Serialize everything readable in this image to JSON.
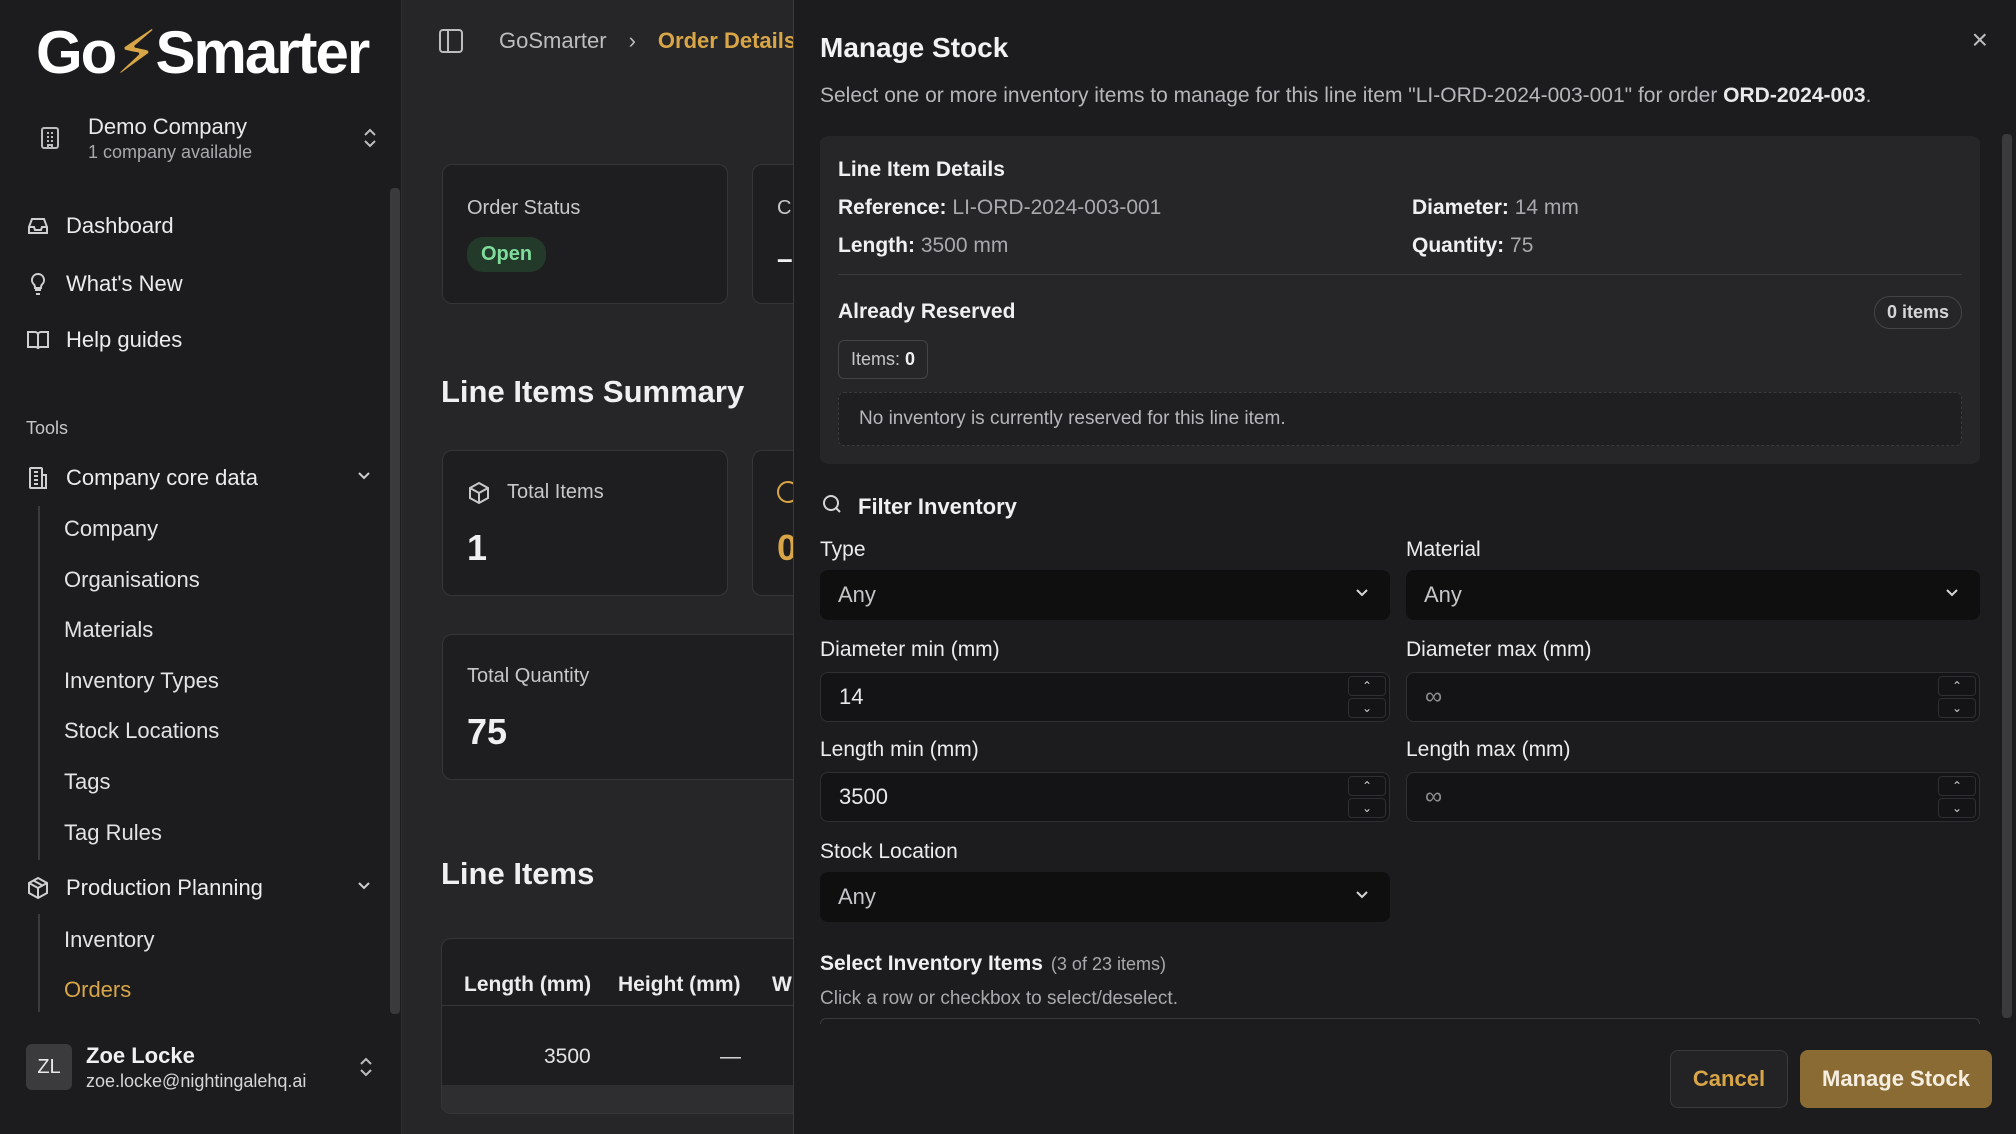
{
  "sidebar": {
    "logo_left": "Go",
    "logo_bolt": "⚡",
    "logo_right": "Smarter",
    "company": {
      "name": "Demo Company",
      "sub": "1 company available"
    },
    "nav": [
      {
        "label": "Dashboard",
        "icon": "inbox-icon"
      },
      {
        "label": "What's New",
        "icon": "lightbulb-icon"
      },
      {
        "label": "Help guides",
        "icon": "book-icon"
      }
    ],
    "tools_label": "Tools",
    "group_core": "Company core data",
    "core_items": [
      "Company",
      "Organisations",
      "Materials",
      "Inventory Types",
      "Stock Locations",
      "Tags",
      "Tag Rules"
    ],
    "group_planning": "Production Planning",
    "planning_items": [
      "Inventory",
      "Orders"
    ],
    "user": {
      "initials": "ZL",
      "name": "Zoe Locke",
      "email": "zoe.locke@nightingalehq.ai"
    }
  },
  "main": {
    "breadcrumb": [
      "GoSmarter",
      "Order Details"
    ],
    "order_status_label": "Order Status",
    "order_status_value": "Open",
    "second_card_label": "C",
    "second_card_value": "–",
    "summary_title": "Line Items Summary",
    "total_items_label": "Total Items",
    "total_items_value": "1",
    "partial_value": "0",
    "total_quantity_label": "Total Quantity",
    "total_quantity_value": "75",
    "line_items_title": "Line Items",
    "table_headers": [
      "Length (mm)",
      "Height (mm)",
      "W"
    ],
    "table_row": [
      "3500",
      "—"
    ]
  },
  "dialog": {
    "title": "Manage Stock",
    "desc_prefix": "Select one or more inventory items to manage for this line item \"LI-ORD-2024-003-001\" for order ",
    "desc_order": "ORD-2024-003",
    "desc_suffix": ".",
    "close": "×",
    "line_item_details": {
      "heading": "Line Item Details",
      "reference_label": "Reference:",
      "reference_value": "LI-ORD-2024-003-001",
      "diameter_label": "Diameter:",
      "diameter_value": "14 mm",
      "length_label": "Length:",
      "length_value": "3500 mm",
      "quantity_label": "Quantity:",
      "quantity_value": "75"
    },
    "already_reserved": {
      "heading": "Already Reserved",
      "pill": "0 items",
      "items_label": "Items:",
      "items_value": "0",
      "empty": "No inventory is currently reserved for this line item."
    },
    "filter": {
      "heading": "Filter Inventory",
      "type_label": "Type",
      "type_value": "Any",
      "material_label": "Material",
      "material_value": "Any",
      "dmin_label": "Diameter min (mm)",
      "dmin_value": "14",
      "dmax_label": "Diameter max (mm)",
      "dmax_placeholder": "∞",
      "lmin_label": "Length min (mm)",
      "lmin_value": "3500",
      "lmax_label": "Length max (mm)",
      "lmax_placeholder": "∞",
      "location_label": "Stock Location",
      "location_value": "Any"
    },
    "select": {
      "heading": "Select Inventory Items",
      "count": "(3 of 23 items)",
      "hint": "Click a row or checkbox to select/deselect."
    },
    "cancel_label": "Cancel",
    "submit_label": "Manage Stock"
  }
}
